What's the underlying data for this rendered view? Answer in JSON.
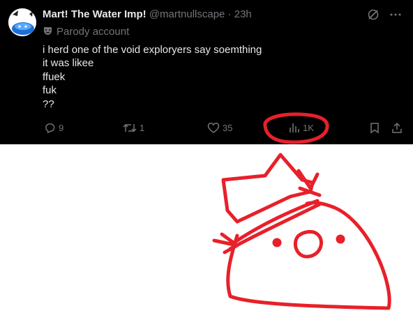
{
  "tweet": {
    "display_name": "Mart! The Water Imp!",
    "handle": "@martnullscape",
    "separator": "·",
    "time": "23h",
    "parody_label": "Parody account",
    "lines": [
      "i herd one of the void explorуers say soemthing",
      "it was likee",
      "ffuek",
      "fuk",
      "??"
    ]
  },
  "actions": {
    "reply_count": "9",
    "repost_count": "1",
    "like_count": "35",
    "view_count": "1K"
  },
  "icons": [
    "avatar",
    "grok-icon",
    "more-icon",
    "reply-icon",
    "repost-icon",
    "like-icon",
    "views-icon",
    "bookmark-icon",
    "share-icon"
  ],
  "colors": {
    "background": "#000000",
    "text": "#e7e9ea",
    "muted": "#71767b",
    "annotation": "#e8202a"
  }
}
